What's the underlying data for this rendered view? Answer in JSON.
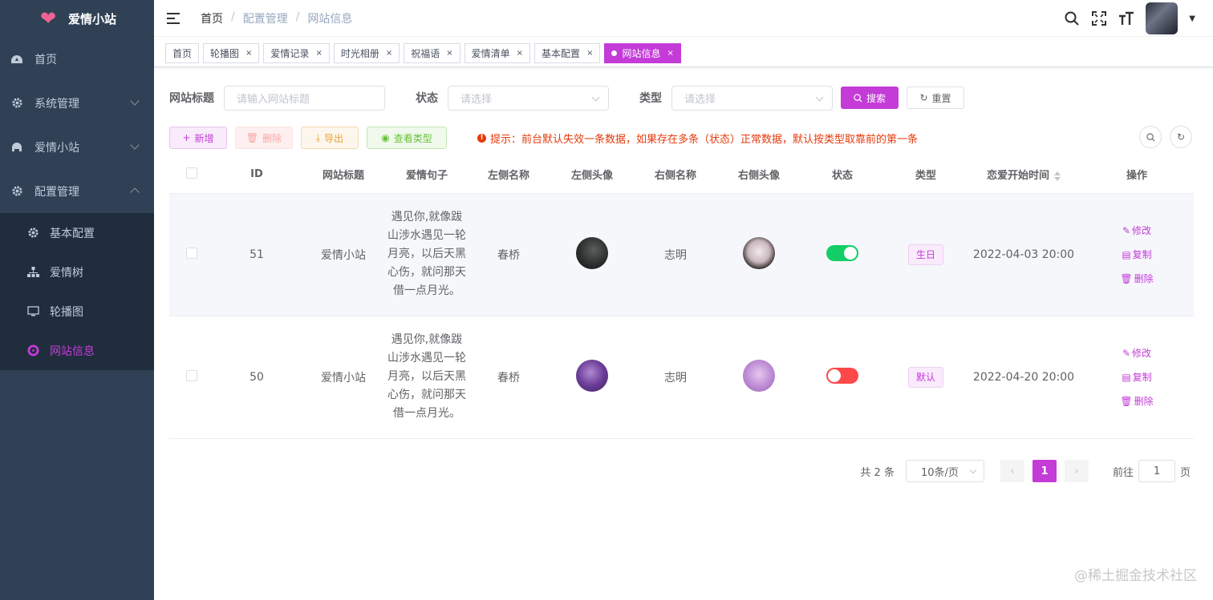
{
  "app": {
    "title": "爱情小站"
  },
  "sidebar": {
    "items": [
      {
        "label": "首页",
        "icon": "dashboard-icon"
      },
      {
        "label": "系统管理",
        "icon": "gear-icon"
      },
      {
        "label": "爱情小站",
        "icon": "couple-icon"
      },
      {
        "label": "配置管理",
        "icon": "gear-icon",
        "expanded": true
      }
    ],
    "sub_items": [
      {
        "label": "基本配置",
        "icon": "gear-icon"
      },
      {
        "label": "爱情树",
        "icon": "tree-icon"
      },
      {
        "label": "轮播图",
        "icon": "monitor-icon"
      },
      {
        "label": "网站信息",
        "icon": "circle-icon",
        "active": true
      }
    ]
  },
  "breadcrumb": [
    "首页",
    "配置管理",
    "网站信息"
  ],
  "tags": [
    "首页",
    "轮播图",
    "爱情记录",
    "时光相册",
    "祝福语",
    "爱情清单",
    "基本配置",
    "网站信息"
  ],
  "filters": {
    "title_label": "网站标题",
    "title_placeholder": "请输入网站标题",
    "status_label": "状态",
    "status_placeholder": "请选择",
    "type_label": "类型",
    "type_placeholder": "请选择",
    "search_label": "搜索",
    "reset_label": "重置"
  },
  "toolbar": {
    "add_label": "新增",
    "delete_label": "删除",
    "export_label": "导出",
    "view_types_label": "查看类型",
    "tip": "提示：前台默认失效一条数据，如果存在多条（状态）正常数据，默认按类型取靠前的第一条"
  },
  "table": {
    "columns": [
      "ID",
      "网站标题",
      "爱情句子",
      "左侧名称",
      "左侧头像",
      "右侧名称",
      "右侧头像",
      "状态",
      "类型",
      "恋爱开始时间",
      "操作"
    ],
    "rows": [
      {
        "id": "51",
        "title": "爱情小站",
        "sentence": "遇见你,就像跋山涉水遇见一轮月亮，以后天黑心伤，就问那天借一点月光。",
        "left_name": "春桥",
        "right_name": "志明",
        "status": true,
        "type": "生日",
        "start_time": "2022-04-03 20:00"
      },
      {
        "id": "50",
        "title": "爱情小站",
        "sentence": "遇见你,就像跋山涉水遇见一轮月亮，以后天黑心伤，就问那天借一点月光。",
        "left_name": "春桥",
        "right_name": "志明",
        "status": false,
        "type": "默认",
        "start_time": "2022-04-20 20:00"
      }
    ],
    "ops": {
      "edit": "修改",
      "copy": "复制",
      "delete": "删除"
    }
  },
  "pagination": {
    "total_text": "共 2 条",
    "page_size": "10条/页",
    "current_page": "1",
    "goto_label": "前往",
    "goto_value": "1",
    "page_suffix": "页"
  },
  "watermark": "@稀土掘金技术社区",
  "colors": {
    "accent": "#c43bd8",
    "sidebar": "#304156",
    "success": "#13ce66",
    "danger": "#ff4949"
  }
}
